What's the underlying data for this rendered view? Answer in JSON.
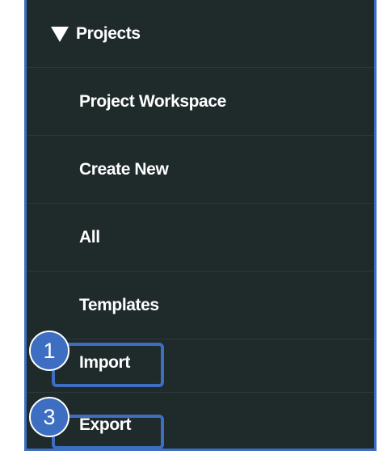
{
  "menu": {
    "header": {
      "label": "Projects",
      "icon": "triangle-down-icon"
    },
    "items": [
      {
        "label": "Project Workspace"
      },
      {
        "label": "Create New"
      },
      {
        "label": "All"
      },
      {
        "label": "Templates"
      },
      {
        "label": "Import"
      },
      {
        "label": "Export"
      }
    ]
  },
  "annotations": {
    "import_step": "1",
    "export_step": "3"
  },
  "colors": {
    "panel_bg": "#1f2a2b",
    "accent": "#3d6ec1",
    "text": "#ffffff"
  }
}
